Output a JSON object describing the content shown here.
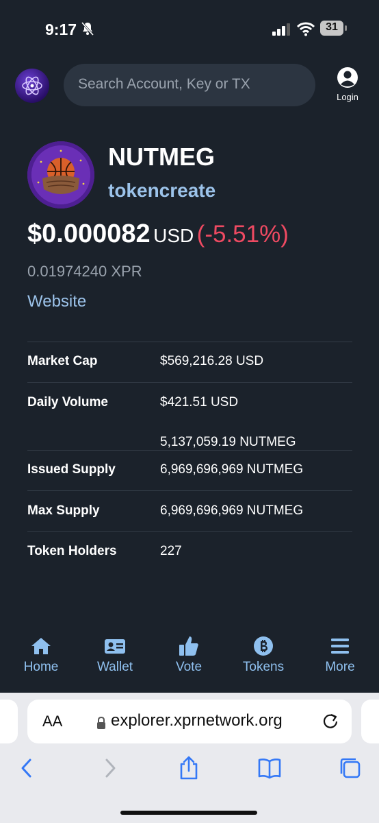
{
  "status": {
    "time": "9:17",
    "battery": "31"
  },
  "header": {
    "search_placeholder": "Search Account, Key or TX",
    "login_label": "Login"
  },
  "token": {
    "name": "NUTMEG",
    "account": "tokencreate",
    "price_usd": "$0.000082",
    "price_unit": "USD",
    "change": "(-5.51%)",
    "price_xpr": "0.01974240 XPR",
    "website_label": "Website"
  },
  "stats": [
    {
      "label": "Market Cap",
      "value": "$569,216.28 USD"
    },
    {
      "label": "Daily Volume",
      "value": "$421.51 USD",
      "value2": "5,137,059.19 NUTMEG"
    },
    {
      "label": "Issued Supply",
      "value": "6,969,696,969 NUTMEG"
    },
    {
      "label": "Max Supply",
      "value": "6,969,696,969 NUTMEG"
    },
    {
      "label": "Token Holders",
      "value": "227"
    }
  ],
  "nav": [
    {
      "label": "Home",
      "icon": "home-icon"
    },
    {
      "label": "Wallet",
      "icon": "wallet-icon"
    },
    {
      "label": "Vote",
      "icon": "thumbs-up-icon"
    },
    {
      "label": "Tokens",
      "icon": "bitcoin-icon"
    },
    {
      "label": "More",
      "icon": "menu-icon"
    }
  ],
  "browser": {
    "aa_label": "AA",
    "url": "explorer.xprnetwork.org"
  },
  "colors": {
    "accent": "#9cc3ea",
    "negative": "#ee4a62",
    "background": "#1b222b"
  }
}
